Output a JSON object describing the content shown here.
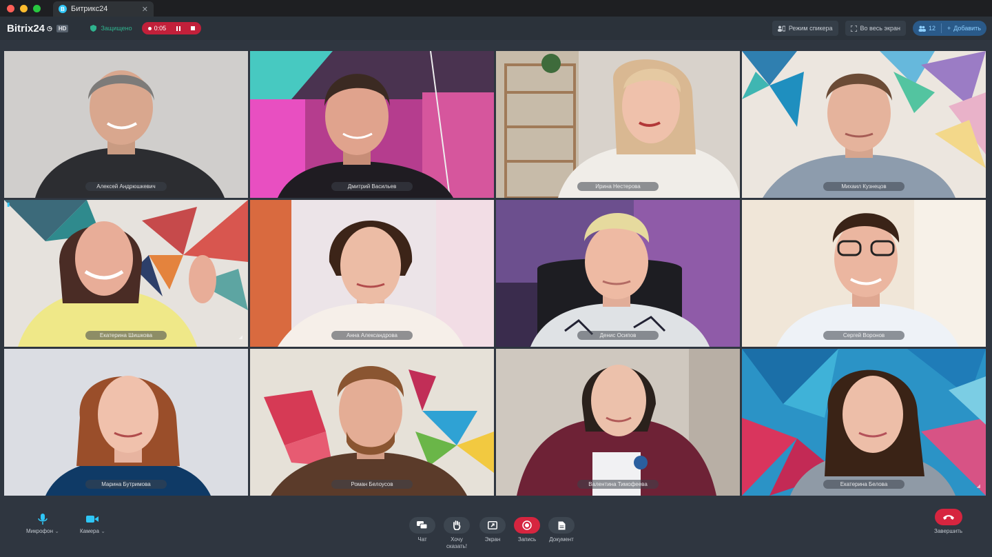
{
  "browser": {
    "tab_title": "Битрикс24",
    "tab_favicon": "B"
  },
  "header": {
    "logo_text": "Bitrix24",
    "hd_badge": "HD",
    "security_label": "Защищено",
    "recording_time": "0:05",
    "speaker_mode_label": "Режим спикера",
    "fullscreen_label": "Во весь экран",
    "participants_count": "12",
    "add_label": "Добавить"
  },
  "participants": [
    {
      "name": "Алексей Андрюшкевич"
    },
    {
      "name": "Дмитрий Васильев"
    },
    {
      "name": "Ирина Нестерова"
    },
    {
      "name": "Михаил Кузнецов"
    },
    {
      "name": "Екатерина Шишкова"
    },
    {
      "name": "Анна Александрова"
    },
    {
      "name": "Денис Осипов"
    },
    {
      "name": "Сергей Воронов"
    },
    {
      "name": "Марина Бутримова"
    },
    {
      "name": "Роман Белоусов"
    },
    {
      "name": "Валентина Тимофеева"
    },
    {
      "name": "Екатерина Белова"
    }
  ],
  "controls": {
    "mic_label": "Микрофон",
    "camera_label": "Камера",
    "chat_label": "Чат",
    "raise_hand_label_1": "Хочу",
    "raise_hand_label_2": "сказать!",
    "screen_label": "Экран",
    "record_label": "Запись",
    "document_label": "Документ",
    "end_label": "Завершить"
  },
  "colors": {
    "accent": "#2fc6f6",
    "record_red": "#d6253f",
    "secure_green": "#2fb38e",
    "background": "#2f3640"
  }
}
